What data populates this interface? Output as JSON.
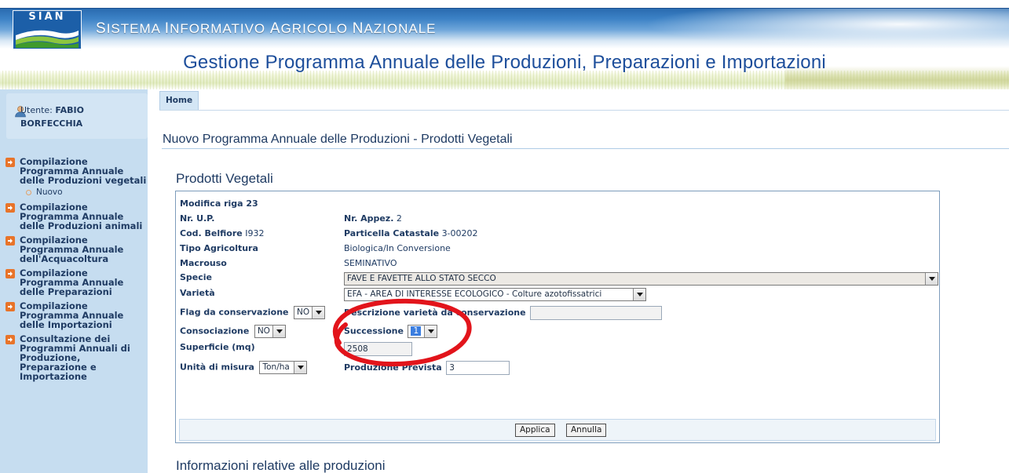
{
  "header": {
    "logo_text": "SIAN",
    "system_title": "Sistema Informativo Agricolo Nazionale",
    "app_title": "Gestione Programma Annuale delle Produzioni, Preparazioni e Importazioni"
  },
  "sidebar": {
    "user_prefix": "Utente:",
    "user_name_1": "FABIO",
    "user_name_2": "BORFECCHIA",
    "menu": [
      {
        "label": "Compilazione Programma Annuale delle Produzioni vegetali"
      },
      {
        "label": "Compilazione Programma Annuale delle Produzioni animali"
      },
      {
        "label": "Compilazione Programma Annuale dell'Acquacoltura"
      },
      {
        "label": "Compilazione Programma Annuale delle Preparazioni"
      },
      {
        "label": "Compilazione Programma Annuale delle Importazioni"
      },
      {
        "label": "Consultazione dei Programmi Annuali di Produzione, Preparazione e Importazione"
      }
    ],
    "submenu_nuovo": "Nuovo"
  },
  "nav": {
    "home": "Home"
  },
  "main": {
    "page_title": "Nuovo Programma Annuale delle Produzioni - Prodotti Vegetali",
    "section_title": "Prodotti Vegetali",
    "bottom_title": "Informazioni relative alle produzioni"
  },
  "form": {
    "modifica_riga": "Modifica riga 23",
    "nr_up_label": "Nr. U.P.",
    "nr_appez_label": "Nr. Appez.",
    "nr_appez_value": "2",
    "cod_belfiore_label": "Cod. Belfiore",
    "cod_belfiore_value": "I932",
    "particella_label": "Particella Catastale",
    "particella_value": "3-00202",
    "tipo_agricoltura_label": "Tipo Agricoltura",
    "tipo_agricoltura_value": "Biologica/In Conversione",
    "macrouso_label": "Macrouso",
    "macrouso_value": "SEMINATIVO",
    "specie_label": "Specie",
    "specie_value": "FAVE E FAVETTE ALLO STATO SECCO",
    "varieta_label": "Varietà",
    "varieta_value": "EFA - AREA DI INTERESSE ECOLOGICO - Colture azotofissatrici",
    "flag_conservazione_label": "Flag da conservazione",
    "flag_conservazione_value": "NO",
    "descrizione_varieta_label": "Descrizione varietà da conservazione",
    "descrizione_varieta_value": "",
    "consociazione_label": "Consociazione",
    "consociazione_value": "NO",
    "successione_label": "Successione",
    "successione_value": "1",
    "superficie_label": "Superficie (mq)",
    "superficie_value": "2508",
    "unita_misura_label": "Unità di misura",
    "unita_misura_value": "Ton/ha",
    "produzione_prevista_label": "Produzione Prevista",
    "produzione_prevista_value": "3",
    "applica_label": "Applica",
    "annulla_label": "Annulla"
  },
  "colors": {
    "header_blue": "#2a6bb0",
    "title_blue": "#1d4e9b",
    "sidebar_bg": "#c6ddf0",
    "menu_arrow": "#e8742a",
    "annotation_red": "#e2141b"
  }
}
